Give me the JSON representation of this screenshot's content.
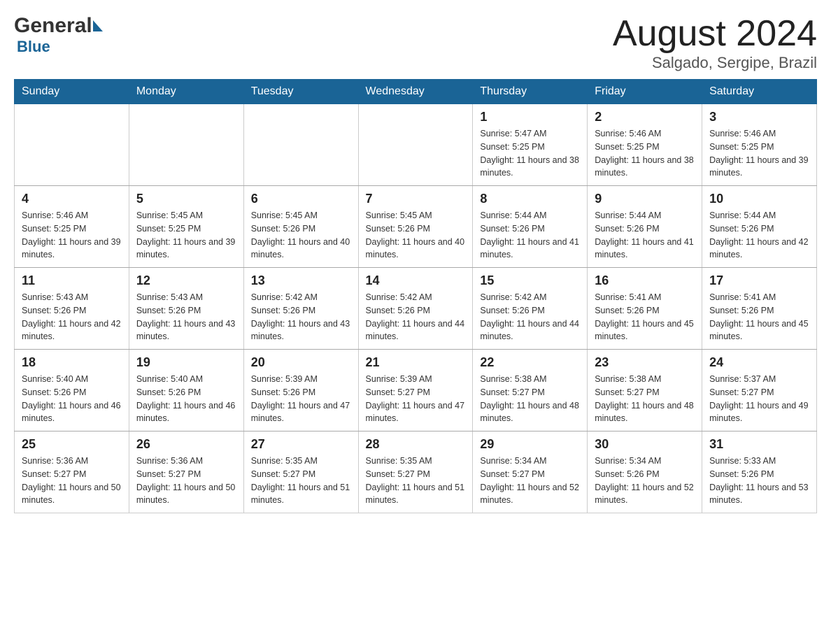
{
  "header": {
    "logo_general": "General",
    "logo_blue": "Blue",
    "month_title": "August 2024",
    "location": "Salgado, Sergipe, Brazil"
  },
  "weekdays": [
    "Sunday",
    "Monday",
    "Tuesday",
    "Wednesday",
    "Thursday",
    "Friday",
    "Saturday"
  ],
  "weeks": [
    [
      {
        "day": "",
        "sunrise": "",
        "sunset": "",
        "daylight": ""
      },
      {
        "day": "",
        "sunrise": "",
        "sunset": "",
        "daylight": ""
      },
      {
        "day": "",
        "sunrise": "",
        "sunset": "",
        "daylight": ""
      },
      {
        "day": "",
        "sunrise": "",
        "sunset": "",
        "daylight": ""
      },
      {
        "day": "1",
        "sunrise": "Sunrise: 5:47 AM",
        "sunset": "Sunset: 5:25 PM",
        "daylight": "Daylight: 11 hours and 38 minutes."
      },
      {
        "day": "2",
        "sunrise": "Sunrise: 5:46 AM",
        "sunset": "Sunset: 5:25 PM",
        "daylight": "Daylight: 11 hours and 38 minutes."
      },
      {
        "day": "3",
        "sunrise": "Sunrise: 5:46 AM",
        "sunset": "Sunset: 5:25 PM",
        "daylight": "Daylight: 11 hours and 39 minutes."
      }
    ],
    [
      {
        "day": "4",
        "sunrise": "Sunrise: 5:46 AM",
        "sunset": "Sunset: 5:25 PM",
        "daylight": "Daylight: 11 hours and 39 minutes."
      },
      {
        "day": "5",
        "sunrise": "Sunrise: 5:45 AM",
        "sunset": "Sunset: 5:25 PM",
        "daylight": "Daylight: 11 hours and 39 minutes."
      },
      {
        "day": "6",
        "sunrise": "Sunrise: 5:45 AM",
        "sunset": "Sunset: 5:26 PM",
        "daylight": "Daylight: 11 hours and 40 minutes."
      },
      {
        "day": "7",
        "sunrise": "Sunrise: 5:45 AM",
        "sunset": "Sunset: 5:26 PM",
        "daylight": "Daylight: 11 hours and 40 minutes."
      },
      {
        "day": "8",
        "sunrise": "Sunrise: 5:44 AM",
        "sunset": "Sunset: 5:26 PM",
        "daylight": "Daylight: 11 hours and 41 minutes."
      },
      {
        "day": "9",
        "sunrise": "Sunrise: 5:44 AM",
        "sunset": "Sunset: 5:26 PM",
        "daylight": "Daylight: 11 hours and 41 minutes."
      },
      {
        "day": "10",
        "sunrise": "Sunrise: 5:44 AM",
        "sunset": "Sunset: 5:26 PM",
        "daylight": "Daylight: 11 hours and 42 minutes."
      }
    ],
    [
      {
        "day": "11",
        "sunrise": "Sunrise: 5:43 AM",
        "sunset": "Sunset: 5:26 PM",
        "daylight": "Daylight: 11 hours and 42 minutes."
      },
      {
        "day": "12",
        "sunrise": "Sunrise: 5:43 AM",
        "sunset": "Sunset: 5:26 PM",
        "daylight": "Daylight: 11 hours and 43 minutes."
      },
      {
        "day": "13",
        "sunrise": "Sunrise: 5:42 AM",
        "sunset": "Sunset: 5:26 PM",
        "daylight": "Daylight: 11 hours and 43 minutes."
      },
      {
        "day": "14",
        "sunrise": "Sunrise: 5:42 AM",
        "sunset": "Sunset: 5:26 PM",
        "daylight": "Daylight: 11 hours and 44 minutes."
      },
      {
        "day": "15",
        "sunrise": "Sunrise: 5:42 AM",
        "sunset": "Sunset: 5:26 PM",
        "daylight": "Daylight: 11 hours and 44 minutes."
      },
      {
        "day": "16",
        "sunrise": "Sunrise: 5:41 AM",
        "sunset": "Sunset: 5:26 PM",
        "daylight": "Daylight: 11 hours and 45 minutes."
      },
      {
        "day": "17",
        "sunrise": "Sunrise: 5:41 AM",
        "sunset": "Sunset: 5:26 PM",
        "daylight": "Daylight: 11 hours and 45 minutes."
      }
    ],
    [
      {
        "day": "18",
        "sunrise": "Sunrise: 5:40 AM",
        "sunset": "Sunset: 5:26 PM",
        "daylight": "Daylight: 11 hours and 46 minutes."
      },
      {
        "day": "19",
        "sunrise": "Sunrise: 5:40 AM",
        "sunset": "Sunset: 5:26 PM",
        "daylight": "Daylight: 11 hours and 46 minutes."
      },
      {
        "day": "20",
        "sunrise": "Sunrise: 5:39 AM",
        "sunset": "Sunset: 5:26 PM",
        "daylight": "Daylight: 11 hours and 47 minutes."
      },
      {
        "day": "21",
        "sunrise": "Sunrise: 5:39 AM",
        "sunset": "Sunset: 5:27 PM",
        "daylight": "Daylight: 11 hours and 47 minutes."
      },
      {
        "day": "22",
        "sunrise": "Sunrise: 5:38 AM",
        "sunset": "Sunset: 5:27 PM",
        "daylight": "Daylight: 11 hours and 48 minutes."
      },
      {
        "day": "23",
        "sunrise": "Sunrise: 5:38 AM",
        "sunset": "Sunset: 5:27 PM",
        "daylight": "Daylight: 11 hours and 48 minutes."
      },
      {
        "day": "24",
        "sunrise": "Sunrise: 5:37 AM",
        "sunset": "Sunset: 5:27 PM",
        "daylight": "Daylight: 11 hours and 49 minutes."
      }
    ],
    [
      {
        "day": "25",
        "sunrise": "Sunrise: 5:36 AM",
        "sunset": "Sunset: 5:27 PM",
        "daylight": "Daylight: 11 hours and 50 minutes."
      },
      {
        "day": "26",
        "sunrise": "Sunrise: 5:36 AM",
        "sunset": "Sunset: 5:27 PM",
        "daylight": "Daylight: 11 hours and 50 minutes."
      },
      {
        "day": "27",
        "sunrise": "Sunrise: 5:35 AM",
        "sunset": "Sunset: 5:27 PM",
        "daylight": "Daylight: 11 hours and 51 minutes."
      },
      {
        "day": "28",
        "sunrise": "Sunrise: 5:35 AM",
        "sunset": "Sunset: 5:27 PM",
        "daylight": "Daylight: 11 hours and 51 minutes."
      },
      {
        "day": "29",
        "sunrise": "Sunrise: 5:34 AM",
        "sunset": "Sunset: 5:27 PM",
        "daylight": "Daylight: 11 hours and 52 minutes."
      },
      {
        "day": "30",
        "sunrise": "Sunrise: 5:34 AM",
        "sunset": "Sunset: 5:26 PM",
        "daylight": "Daylight: 11 hours and 52 minutes."
      },
      {
        "day": "31",
        "sunrise": "Sunrise: 5:33 AM",
        "sunset": "Sunset: 5:26 PM",
        "daylight": "Daylight: 11 hours and 53 minutes."
      }
    ]
  ]
}
